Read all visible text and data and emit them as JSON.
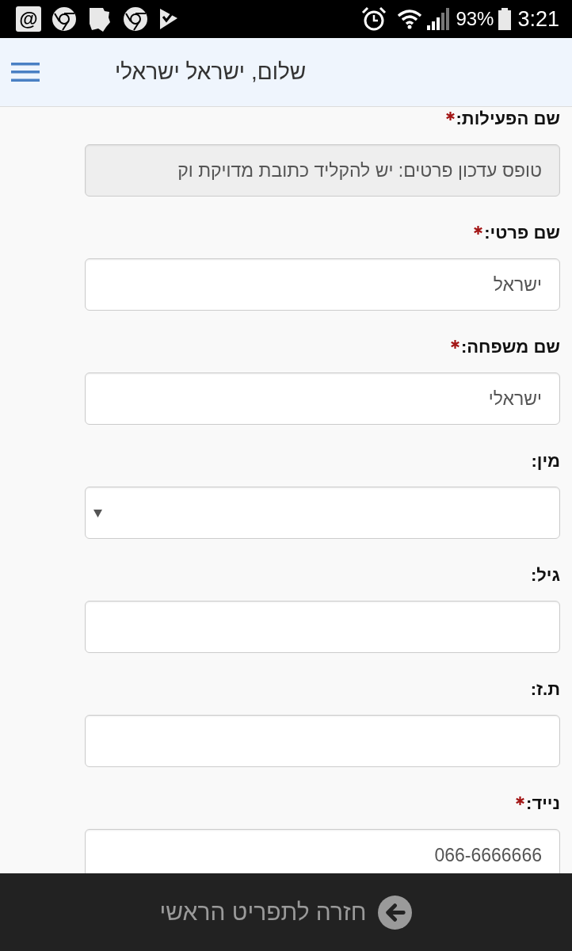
{
  "status_bar": {
    "email_badge": "@",
    "battery": "93%",
    "time": "3:21"
  },
  "header": {
    "title": "שלום, ישראל ישראלי"
  },
  "form": {
    "fields": [
      {
        "label": "שם הפעילות:",
        "required": true,
        "kind": "text",
        "disabled": true,
        "value": "טופס עדכון פרטים: יש להקליד כתובת מדויקת וק"
      },
      {
        "label": "שם פרטי:",
        "required": true,
        "kind": "text",
        "disabled": false,
        "value": "ישראל"
      },
      {
        "label": "שם משפחה:",
        "required": true,
        "kind": "text",
        "disabled": false,
        "value": "ישראלי"
      },
      {
        "label": "מין:",
        "required": false,
        "kind": "select",
        "disabled": false
      },
      {
        "label": "גיל:",
        "required": false,
        "kind": "text",
        "disabled": false
      },
      {
        "label": "ת.ז:",
        "required": false,
        "kind": "text",
        "disabled": false
      },
      {
        "label": "נייד:",
        "required": true,
        "kind": "text",
        "disabled": false,
        "value": "066-6666666"
      }
    ]
  },
  "footer": {
    "back_button": "חזרה לתפריט הראשי"
  }
}
